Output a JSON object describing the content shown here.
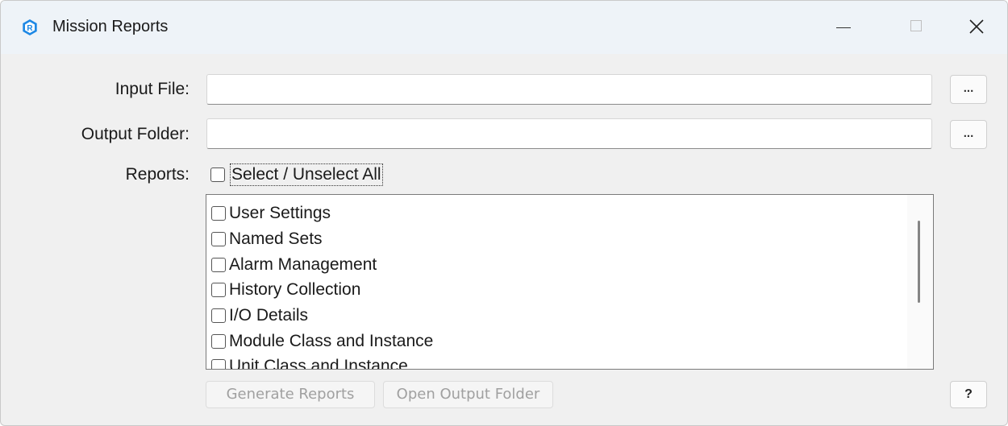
{
  "window": {
    "title": "Mission Reports",
    "icon": "app-logo-icon",
    "accent": "#1e88e5"
  },
  "titlebar_controls": {
    "minimize_icon": "minimize-icon",
    "maximize_icon": "maximize-icon",
    "close_glyph": "✕"
  },
  "form": {
    "input_file": {
      "label": "Input File:",
      "value": "",
      "browse_label": "..."
    },
    "output_folder": {
      "label": "Output Folder:",
      "value": "",
      "browse_label": "..."
    },
    "reports": {
      "label": "Reports:",
      "select_all_label": "Select / Unselect  All",
      "select_all_checked": false,
      "items": [
        {
          "label": "User Settings",
          "checked": false
        },
        {
          "label": "Named Sets",
          "checked": false
        },
        {
          "label": "Alarm Management",
          "checked": false
        },
        {
          "label": "History Collection",
          "checked": false
        },
        {
          "label": "I/O Details",
          "checked": false
        },
        {
          "label": "Module Class and Instance",
          "checked": false
        },
        {
          "label": "Unit Class and Instance",
          "checked": false
        }
      ]
    }
  },
  "actions": {
    "generate_label": "Generate Reports",
    "open_folder_label": "Open Output Folder",
    "help_label": "?"
  }
}
